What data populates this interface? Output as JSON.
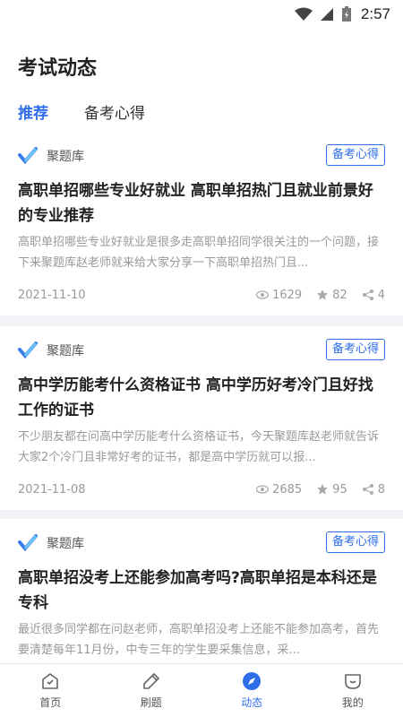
{
  "status": {
    "time": "2:57"
  },
  "header": {
    "title": "考试动态",
    "tabs": [
      {
        "label": "推荐",
        "active": true
      },
      {
        "label": "备考心得",
        "active": false
      }
    ]
  },
  "articles": [
    {
      "source": "聚题库",
      "tag": "备考心得",
      "title": "高职单招哪些专业好就业 高职单招热门且就业前景好的专业推荐",
      "summary": "高职单招哪些专业好就业是很多走高职单招同学很关注的一个问题，接下来聚题库赵老师就来给大家分享一下高职单招热门且...",
      "date": "2021-11-10",
      "views": "1629",
      "stars": "82",
      "shares": "4"
    },
    {
      "source": "聚题库",
      "tag": "备考心得",
      "title": "高中学历能考什么资格证书 高中学历好考冷门且好找工作的证书",
      "summary": "不少朋友都在问高中学历能考什么资格证书，今天聚题库赵老师就告诉大家2个冷门且非常好考的证书，都是高中学历就可以报...",
      "date": "2021-11-08",
      "views": "2685",
      "stars": "95",
      "shares": "8"
    },
    {
      "source": "聚题库",
      "tag": "备考心得",
      "title": "高职单招没考上还能参加高考吗?高职单招是本科还是专科",
      "summary": "最近很多同学都在问赵老师，高职单招没考上还能不能参加高考，首先要清楚每年11月份，中专三年的学生要采集信息，采...",
      "date": "",
      "views": "",
      "stars": "",
      "shares": ""
    }
  ],
  "bottom_nav": [
    {
      "label": "首页",
      "icon": "home-icon",
      "active": false
    },
    {
      "label": "刷题",
      "icon": "pencil-icon",
      "active": false
    },
    {
      "label": "动态",
      "icon": "compass-icon",
      "active": true
    },
    {
      "label": "我的",
      "icon": "profile-icon",
      "active": false
    }
  ],
  "colors": {
    "accent": "#2f6ee8",
    "muted": "#999999",
    "background": "#f2f3f6"
  }
}
